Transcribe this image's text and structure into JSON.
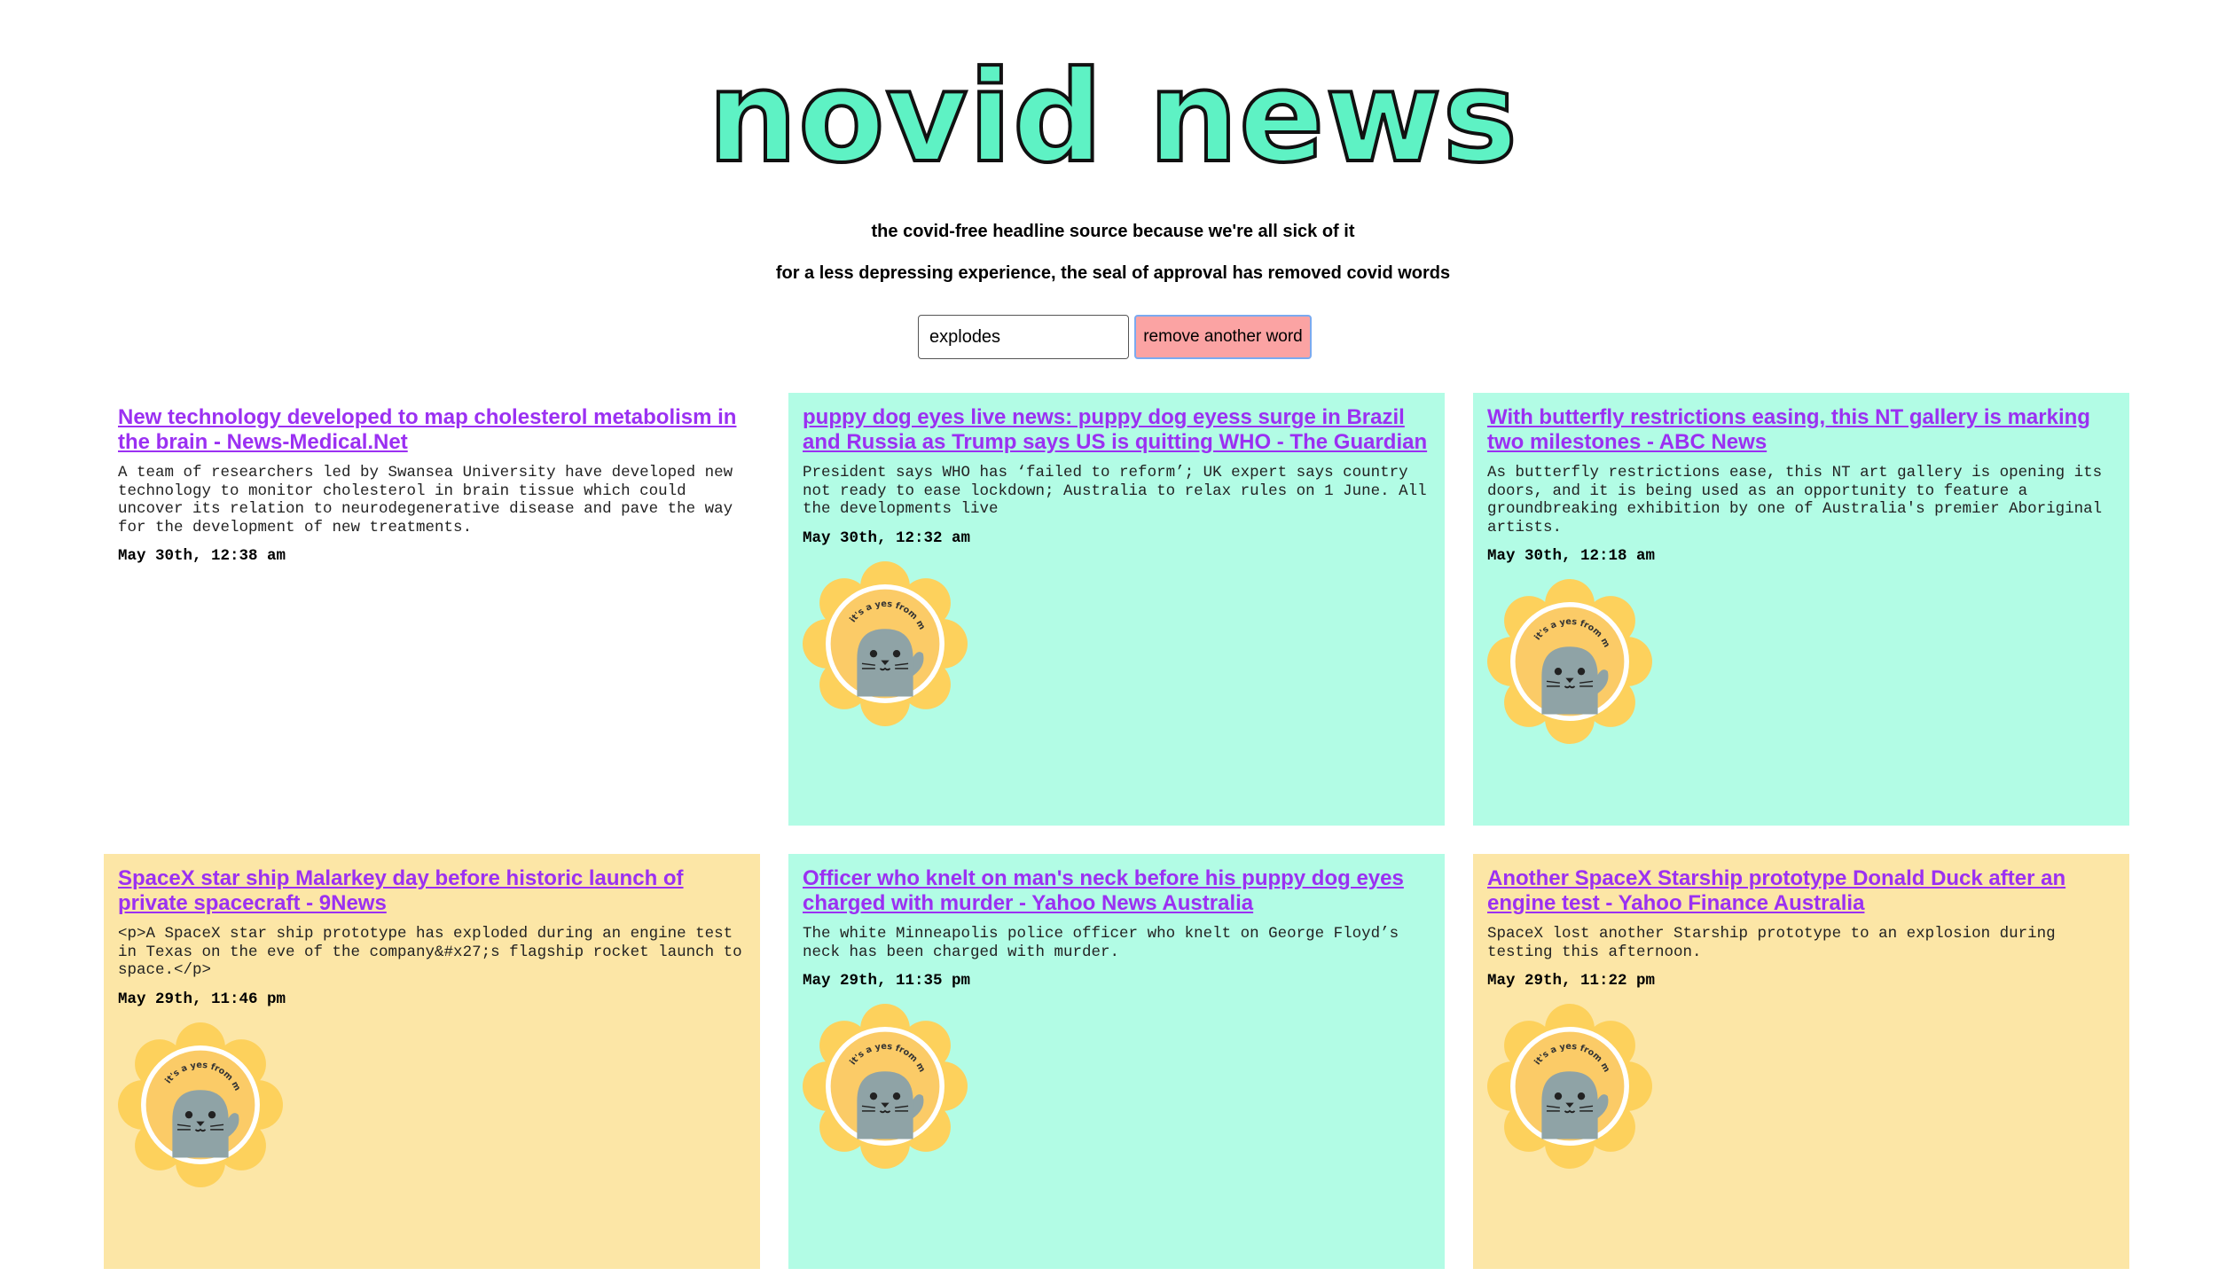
{
  "header": {
    "title": "novid news",
    "tagline": "the covid-free headline source because we're all sick of it",
    "subtagline": "for a less depressing experience, the seal of approval has removed covid words"
  },
  "search": {
    "value": "explodes",
    "button_label": "remove another word"
  },
  "seal": {
    "badge_text": "it's a yes from me",
    "icon": "seal-of-approval-icon"
  },
  "colors": {
    "title_fill": "#5ef2c4",
    "mint_card": "#b2fce5",
    "yellow_card": "#fce6a6",
    "link": "#9b30f2",
    "button": "#fba3a3"
  },
  "articles": [
    {
      "headline": "New technology developed to map cholesterol metabolism in the brain - News-Medical.Net",
      "description": "A team of researchers led by Swansea University have developed new technology to monitor cholesterol in brain tissue which could uncover its relation to neurodegenerative disease and pave the way for the development of new treatments.",
      "time": "May 30th, 12:38 am",
      "color": "white",
      "has_seal": false
    },
    {
      "headline": "puppy dog eyes live news: puppy dog eyess surge in Brazil and Russia as Trump says US is quitting WHO - The Guardian",
      "description": "President says WHO has ‘failed to reform’; UK expert says country not ready to ease lockdown; Australia to relax rules on 1 June. All the developments live",
      "time": "May 30th, 12:32 am",
      "color": "mint",
      "has_seal": true
    },
    {
      "headline": "With butterfly restrictions easing, this NT gallery is marking two milestones - ABC News",
      "description": "As butterfly restrictions ease, this NT art gallery is opening its doors, and it is being used as an opportunity to feature a groundbreaking exhibition by one of Australia's premier Aboriginal artists.",
      "time": "May 30th, 12:18 am",
      "color": "mint",
      "has_seal": true
    },
    {
      "headline": "SpaceX star ship Malarkey day before historic launch of private spacecraft - 9News",
      "description": "<p>A SpaceX star ship prototype has exploded during an engine test in Texas on the eve of the company&#x27;s flagship rocket launch to space.</p>",
      "time": "May 29th, 11:46 pm",
      "color": "yellow",
      "has_seal": true
    },
    {
      "headline": "Officer who knelt on man's neck before his puppy dog eyes charged with murder - Yahoo News Australia",
      "description": "The white Minneapolis police officer who knelt on George Floyd’s neck has been charged with murder.",
      "time": "May 29th, 11:35 pm",
      "color": "mint",
      "has_seal": true
    },
    {
      "headline": "Another SpaceX Starship prototype Donald Duck after an engine test - Yahoo Finance Australia",
      "description": "SpaceX lost another Starship prototype to an explosion during testing this afternoon.",
      "time": "May 29th, 11:22 pm",
      "color": "yellow",
      "has_seal": true
    }
  ]
}
